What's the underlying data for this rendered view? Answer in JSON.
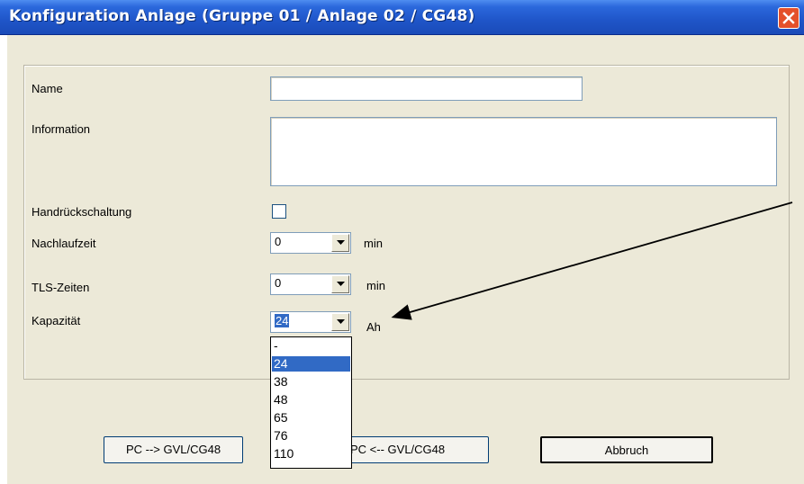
{
  "window": {
    "title": "Konfiguration Anlage (Gruppe 01 / Anlage 02 / CG48)",
    "close_icon": "close-icon"
  },
  "form": {
    "name_label": "Name",
    "name_value": "",
    "information_label": "Information",
    "information_value": "",
    "handrueck_label": "Handrückschaltung",
    "handrueck_checked": false,
    "nachlauf_label": "Nachlaufzeit",
    "nachlauf_value": "0",
    "nachlauf_unit": "min",
    "tls_label": "TLS-Zeiten",
    "tls_value": "0",
    "tls_unit": "min",
    "kapazitaet_label": "Kapazität",
    "kapazitaet_value": "24",
    "kapazitaet_unit": "Ah"
  },
  "kapazitaet_dropdown": {
    "options": [
      "-",
      "24",
      "38",
      "48",
      "65",
      "76",
      "110"
    ],
    "selected": "24"
  },
  "buttons": {
    "pc_to_gvl": "PC --> GVL/CG48",
    "gvl_to_pc": "PC <-- GVL/CG48",
    "cancel": "Abbruch"
  },
  "colors": {
    "titlebar": "#2b68dc",
    "dialog_bg": "#ece9d8",
    "selection": "#316ac5",
    "close_button": "#e4502a"
  }
}
